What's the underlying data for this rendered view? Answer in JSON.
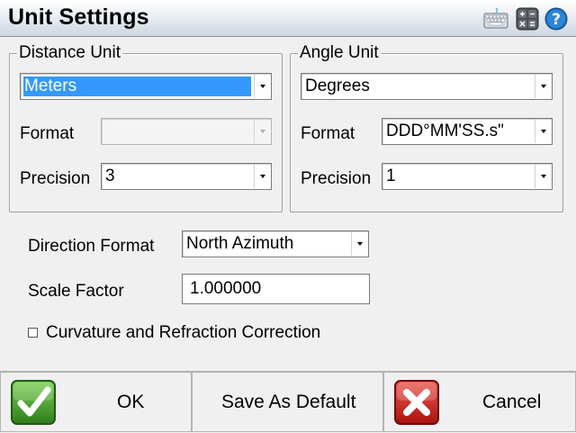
{
  "window": {
    "title": "Unit Settings"
  },
  "toolbar_icons": [
    "keyboard-icon",
    "calculator-icon",
    "help-icon"
  ],
  "distance_unit": {
    "legend": "Distance Unit",
    "unit": "Meters",
    "format_label": "Format",
    "format_value": "",
    "precision_label": "Precision",
    "precision_value": "3"
  },
  "angle_unit": {
    "legend": "Angle Unit",
    "unit": "Degrees",
    "format_label": "Format",
    "format_value": "DDD°MM'SS.s\"",
    "precision_label": "Precision",
    "precision_value": "1"
  },
  "direction_format": {
    "label": "Direction Format",
    "value": "North Azimuth"
  },
  "scale_factor": {
    "label": "Scale Factor",
    "value": "1.000000"
  },
  "curvature": {
    "label": "Curvature and Refraction Correction",
    "checked": false
  },
  "buttons": {
    "ok": "OK",
    "save_default": "Save As Default",
    "cancel": "Cancel"
  },
  "colors": {
    "selection": "#3399ff",
    "ok_green": "#3c8f2a",
    "cancel_red": "#c8201c"
  }
}
